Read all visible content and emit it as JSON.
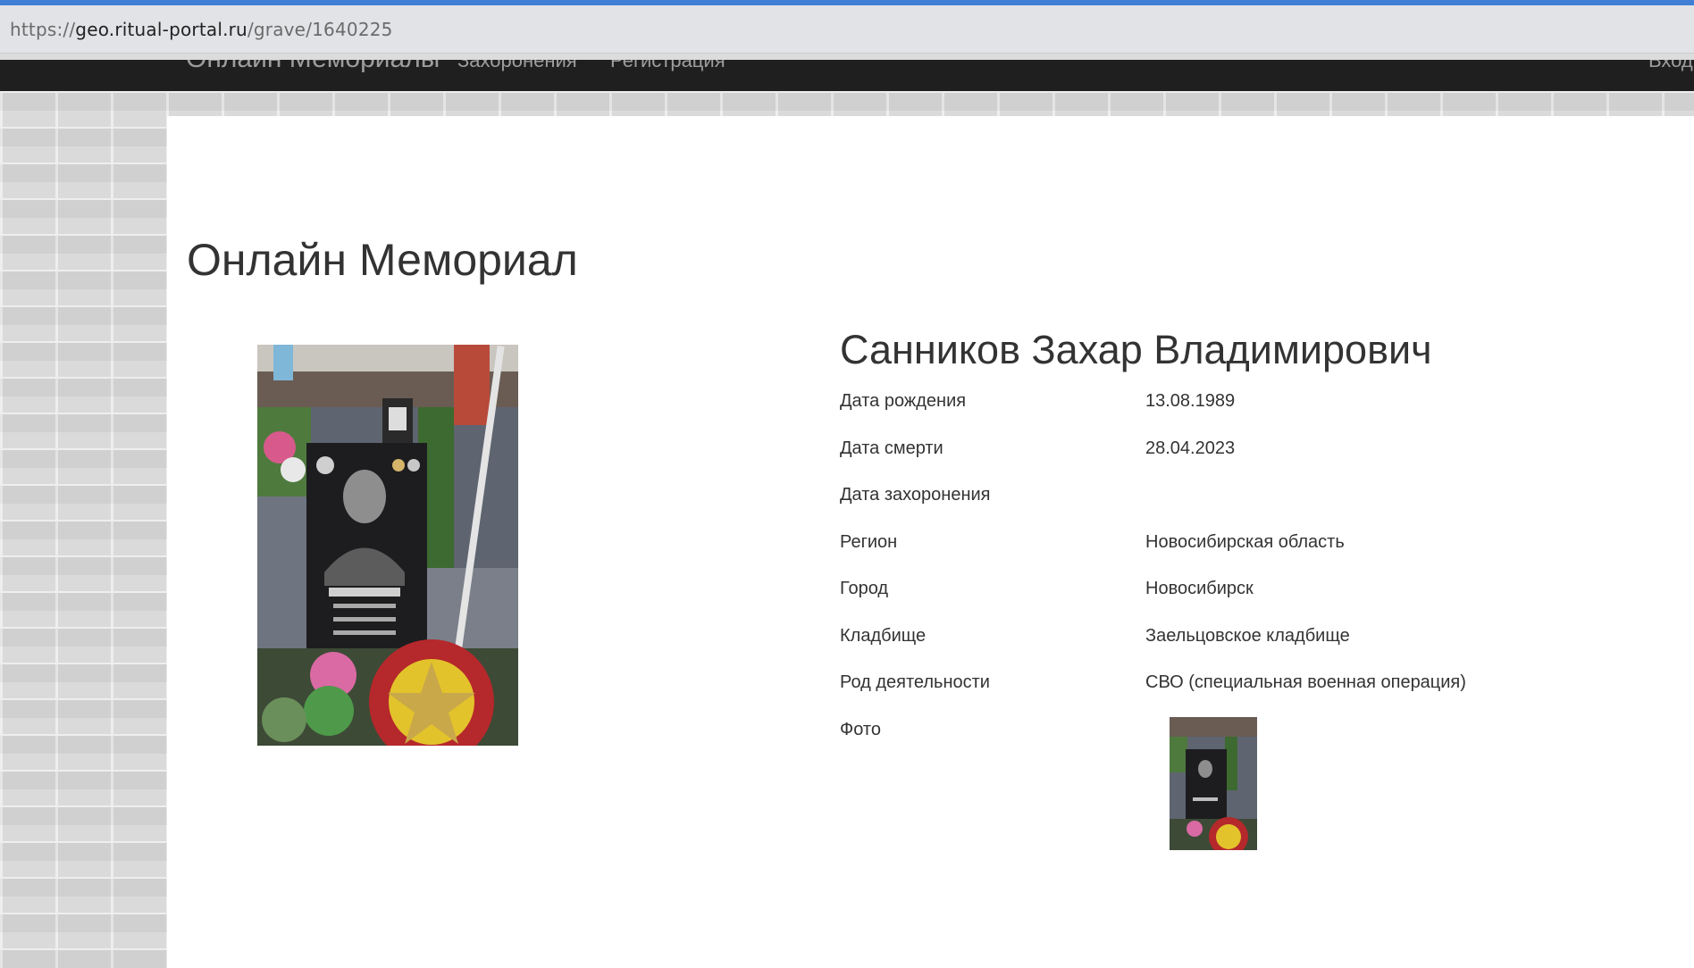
{
  "browser": {
    "url_protocol": "https://",
    "url_domain": "geo.ritual-portal.ru",
    "url_path": "/grave/1640225"
  },
  "navbar": {
    "brand": "Онлайн Мемориалы",
    "item1": "Захоронения",
    "item2": "Регистрация",
    "right": "Вход"
  },
  "page": {
    "title": "Онлайн Мемориал"
  },
  "person": {
    "name": "Санников Захар Владимирович",
    "rows": [
      {
        "label": "Дата рождения",
        "value": "13.08.1989"
      },
      {
        "label": "Дата смерти",
        "value": "28.04.2023"
      },
      {
        "label": "Дата захоронения",
        "value": ""
      },
      {
        "label": "Регион",
        "value": "Новосибирская область"
      },
      {
        "label": "Город",
        "value": "Новосибирск"
      },
      {
        "label": "Кладбище",
        "value": "Заельцовское кладбище"
      },
      {
        "label": "Род деятельности",
        "value": "СВО (специальная военная операция)"
      },
      {
        "label": "Фото",
        "value": ""
      }
    ]
  },
  "colors": {
    "navbar_bg": "#1f1f1f",
    "address_bar_bg": "#e1e3e6",
    "accent_top": "#3f7fd6",
    "content_bg": "#ffffff",
    "text": "#333333"
  }
}
